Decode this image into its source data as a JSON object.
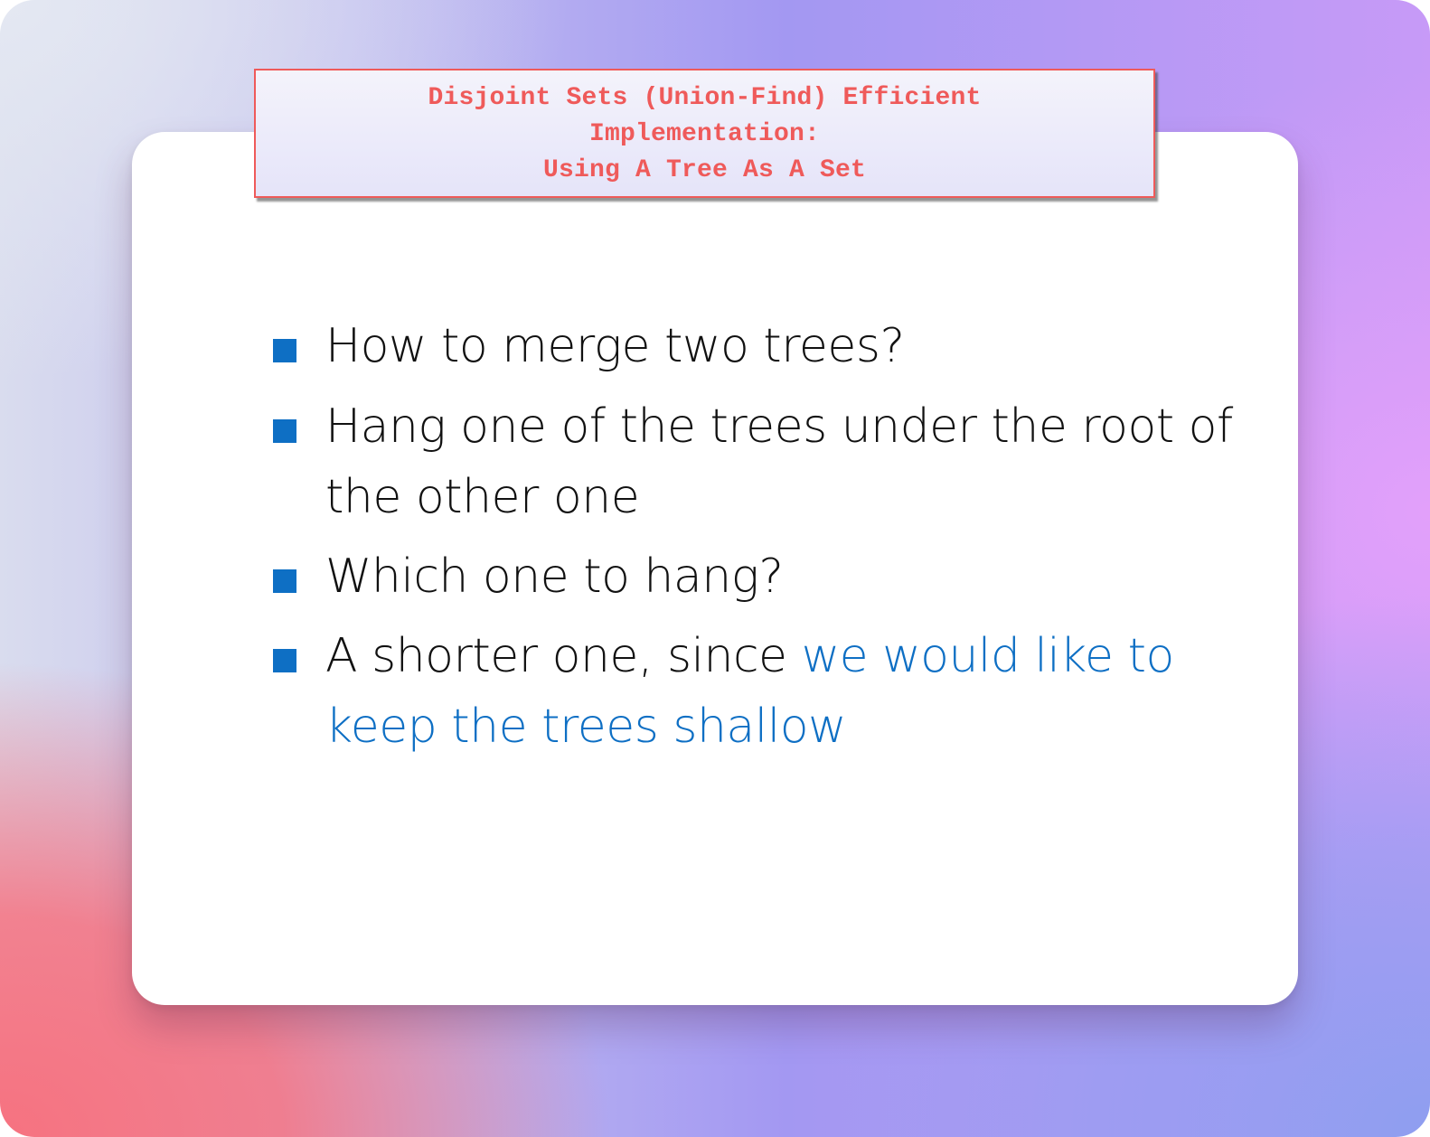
{
  "slide": {
    "title_lines": [
      "Disjoint Sets (Union-Find) Efficient",
      "Implementation:",
      "Using A Tree As A Set"
    ],
    "bullets": [
      {
        "lines": [
          "How to merge two trees?"
        ]
      },
      {
        "lines": [
          "Hang one of the trees under the root of",
          "the other one"
        ]
      },
      {
        "lines": [
          "Which one to hang?"
        ]
      },
      {
        "prefix": "A shorter one, since ",
        "highlight_line1": "we would like to",
        "highlight_line2": "keep the trees shallow"
      }
    ]
  },
  "colors": {
    "title_text": "#ef5a5a",
    "title_border": "#ef5a5a",
    "bullet_marker": "#0e6fc4",
    "highlight_text": "#0e6fc4",
    "body_text": "#111111"
  }
}
